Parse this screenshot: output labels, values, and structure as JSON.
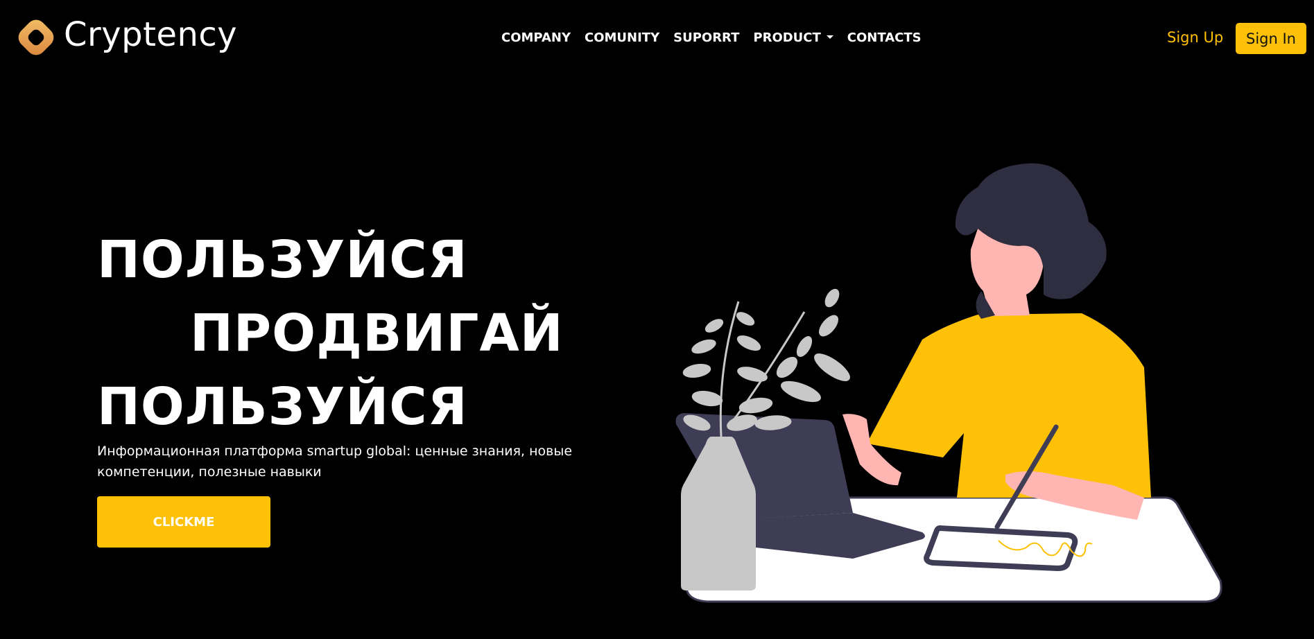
{
  "brand": {
    "name": "Cryptency",
    "logo_icon": "rounded-diamond-logo-icon",
    "colors": {
      "accent": "#FFC107",
      "logo_light": "#F0B25A",
      "logo_dark": "#D9853B"
    }
  },
  "nav": {
    "items": [
      {
        "label": "COMPANY"
      },
      {
        "label": "COMUNITY"
      },
      {
        "label": "SUPORRT"
      },
      {
        "label": "PRODUCT",
        "has_dropdown": true,
        "icon": "caret-down-icon"
      },
      {
        "label": "CONTACTS"
      }
    ]
  },
  "auth": {
    "signup_label": "Sign Up",
    "signin_label": "Sign In"
  },
  "hero": {
    "headline_lines": [
      "ПОЛЬЗУЙСЯ",
      "ПРОДВИГАЙ",
      "ПОЛЬЗУЙСЯ"
    ],
    "subtitle": "Информационная платформа smartup global: ценные знания, новые компетенции, полезные навыки",
    "cta_label": "CLICKME",
    "illustration": "woman-at-desk-with-laptop-tablet-and-plant-illustration"
  }
}
